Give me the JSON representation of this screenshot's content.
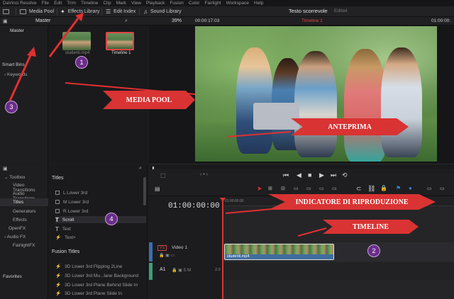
{
  "menu": [
    "DaVinci Resolve",
    "File",
    "Edit",
    "Trim",
    "Timeline",
    "Clip",
    "Mark",
    "View",
    "Playback",
    "Fusion",
    "Color",
    "Fairlight",
    "Workspace",
    "Help"
  ],
  "toolbar": {
    "media_pool": "Media Pool",
    "effects_library": "Effects Library",
    "edit_index": "Edit Index",
    "sound_library": "Sound Library",
    "project_title": "Testo scorrevole",
    "edited": "Edited"
  },
  "bin": {
    "master_header": "Master",
    "master": "Master",
    "smart_bins": "Smart Bins",
    "keywords": "Keywords"
  },
  "media": {
    "clips": [
      {
        "name": "studenti.mp4"
      },
      {
        "name": "Timeline 1"
      }
    ]
  },
  "viewer": {
    "zoom": "39%",
    "timecode_in": "00:00:17:03",
    "timeline_name": "Timeline 1",
    "timecode_right": "01:00:00:"
  },
  "effects": {
    "tree": [
      "Toolbox",
      "Video Transitions",
      "Audio Transitions",
      "Titles",
      "Generators",
      "Effects",
      "OpenFX",
      "Audio FX",
      "FairlightFX"
    ],
    "favorites": "Favorites",
    "titles_header": "Titles",
    "titles": [
      "L Lower 3rd",
      "M Lower 3rd",
      "R Lower 3rd",
      "Scroll",
      "Text",
      "Text+"
    ],
    "fusion_header": "Fusion Titles",
    "fusion": [
      "3D Lower 3rd Flipping 2Line",
      "3D Lower 3rd Mu...lane Background",
      "3D Lower 3rd Plane Behind Slide In",
      "3D Lower 3rd Plane Slide In"
    ]
  },
  "timeline": {
    "timecode": "01:00:00:00",
    "ruler_tc": "01:00:00:00",
    "v1_badge": "V1",
    "v1_name": "Video 1",
    "a1_name": "A1",
    "a1_value": "2.0",
    "clip_name": "studenti.mp4"
  },
  "annotations": {
    "media_pool": "MEDIA POOL",
    "anteprima": "ANTEPRIMA",
    "indicatore": "INDICATORE DI RIPRODUZIONE",
    "timeline": "TIMELINE",
    "badges": [
      "1",
      "2",
      "3",
      "4"
    ]
  },
  "colors": {
    "callout": "#d93333",
    "badge": "#6b2d8a",
    "playhead": "#dd3333",
    "clip_label": "#3f6d9e"
  }
}
